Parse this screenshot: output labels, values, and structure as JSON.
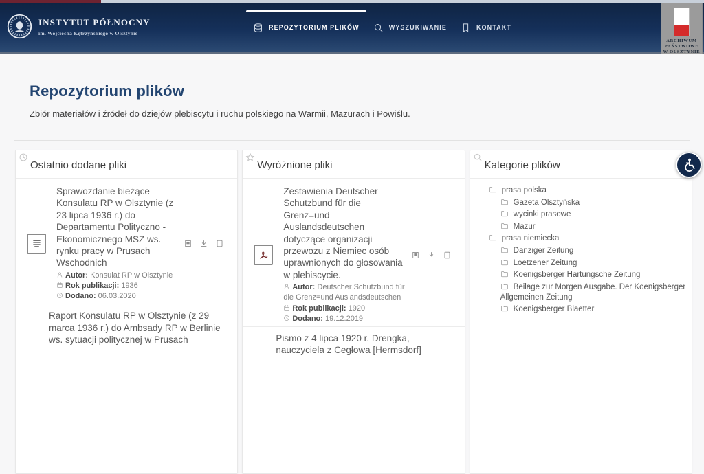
{
  "colors": {
    "navbar_navy": "#0f2443",
    "top_strip_red": "#6e2331",
    "top_strip_silver": "#c8d0da",
    "flag_red": "#d42b2b",
    "page_title_blue": "#234571",
    "accessibility_bg": "#12294c"
  },
  "brand": {
    "title": "INSTYTUT PÓŁNOCNY",
    "subtitle": "im. Wojciecha Kętrzyńskiego w Olsztynie",
    "seal_icon": "portrait-seal-icon"
  },
  "nav": {
    "items": [
      {
        "label": "REPOZYTORIUM PLIKÓW",
        "icon": "database-icon",
        "active": true
      },
      {
        "label": "WYSZUKIWANIE",
        "icon": "search-icon",
        "active": false
      },
      {
        "label": "KONTAKT",
        "icon": "bookmark-icon",
        "active": false
      }
    ]
  },
  "partner": {
    "icon": "polish-flag-emblem",
    "line1": "ARCHIWUM",
    "line2": "PAŃSTWOWE",
    "line3": "W OLSZTYNIE"
  },
  "page": {
    "title": "Repozytorium plików",
    "subtitle": "Zbiór materiałów i źródeł do dziejów plebiscytu i ruchu polskiego na Warmii, Mazurach i Powiślu."
  },
  "recent": {
    "title": "Ostatnio dodane pliki",
    "icon": "clock-icon",
    "items": [
      {
        "file_icon": "document-icon",
        "title": "Sprawozdanie bieżące Konsulatu RP w Olsztynie (z 23 lipca 1936 r.) do Departamentu Polityczno - Ekonomicznego MSZ ws. rynku pracy w Prusach Wschodnich",
        "author_label": "Autor:",
        "author": "Konsulat RP w Olsztynie",
        "year_label": "Rok publikacji:",
        "year": "1936",
        "added_label": "Dodano:",
        "added": "06.03.2020"
      },
      {
        "title": "Raport Konsulatu RP w Olsztynie (z 29 marca 1936 r.) do Ambsady RP w Berlinie ws. sytuacji politycznej w Prusach"
      }
    ]
  },
  "featured": {
    "title": "Wyróżnione pliki",
    "icon": "star-icon",
    "items": [
      {
        "file_icon": "pdf-file-icon",
        "title": "Zestawienia Deutscher Schutzbund für die Grenz=und Auslandsdeutschen dotyczące organizacji przewozu z Niemiec osób uprawnionych do głosowania w plebiscycie.",
        "author_label": "Autor:",
        "author": "Deutscher Schutzbund für die Grenz=und Auslandsdeutschen",
        "year_label": "Rok publikacji:",
        "year": "1920",
        "added_label": "Dodano:",
        "added": "19.12.2019"
      },
      {
        "title": "Pismo z 4 lipca 1920 r. Drengka, nauczyciela z Cegłowa [Hermsdorf]"
      }
    ]
  },
  "categories": {
    "title": "Kategorie plików",
    "icon": "search-icon",
    "tree": [
      {
        "label": "prasa polska",
        "level": 0
      },
      {
        "label": "Gazeta Olsztyńska",
        "level": 1
      },
      {
        "label": "wycinki prasowe",
        "level": 1
      },
      {
        "label": "Mazur",
        "level": 1
      },
      {
        "label": "prasa niemiecka",
        "level": 0
      },
      {
        "label": "Danziger Zeitung",
        "level": 1
      },
      {
        "label": "Loetzener Zeitung",
        "level": 1
      },
      {
        "label": "Koenigsberger Hartungsche Zeitung",
        "level": 1
      },
      {
        "label": "Beilage zur Morgen Ausgabe. Der Koenigsberger Allgemeinen Zeitung",
        "level": 1
      },
      {
        "label": "Koenigsberger Blaetter",
        "level": 1
      }
    ]
  },
  "accessibility": {
    "icon": "wheelchair-icon"
  }
}
